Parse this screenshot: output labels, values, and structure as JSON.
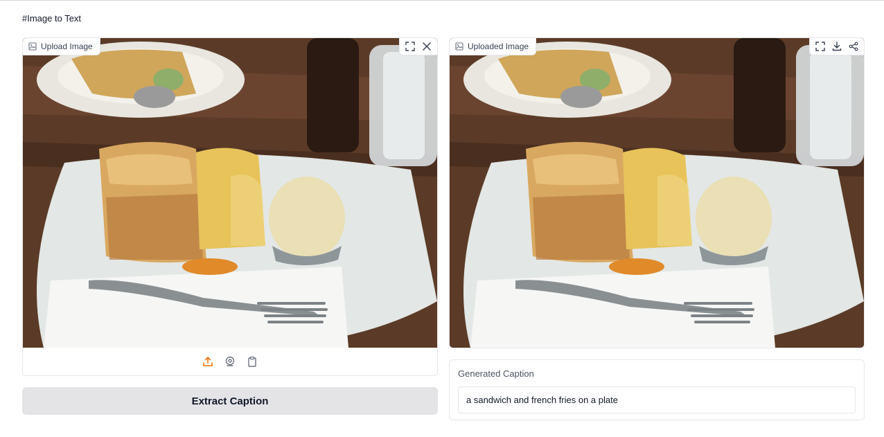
{
  "app": {
    "title": "#Image to Text"
  },
  "input_panel": {
    "label": "Upload Image",
    "label_icon": "image-icon",
    "tools": [
      "fullscreen-icon",
      "close-icon"
    ],
    "sources": [
      "upload-icon",
      "webcam-icon",
      "clipboard-icon"
    ],
    "active_source_color": "#f97316"
  },
  "output_panel": {
    "label": "Uploaded Image",
    "label_icon": "image-icon",
    "tools": [
      "fullscreen-icon",
      "download-icon",
      "share-icon"
    ]
  },
  "actions": {
    "extract_label": "Extract Caption"
  },
  "caption": {
    "label": "Generated Caption",
    "value": "a sandwich and french fries on a plate"
  }
}
